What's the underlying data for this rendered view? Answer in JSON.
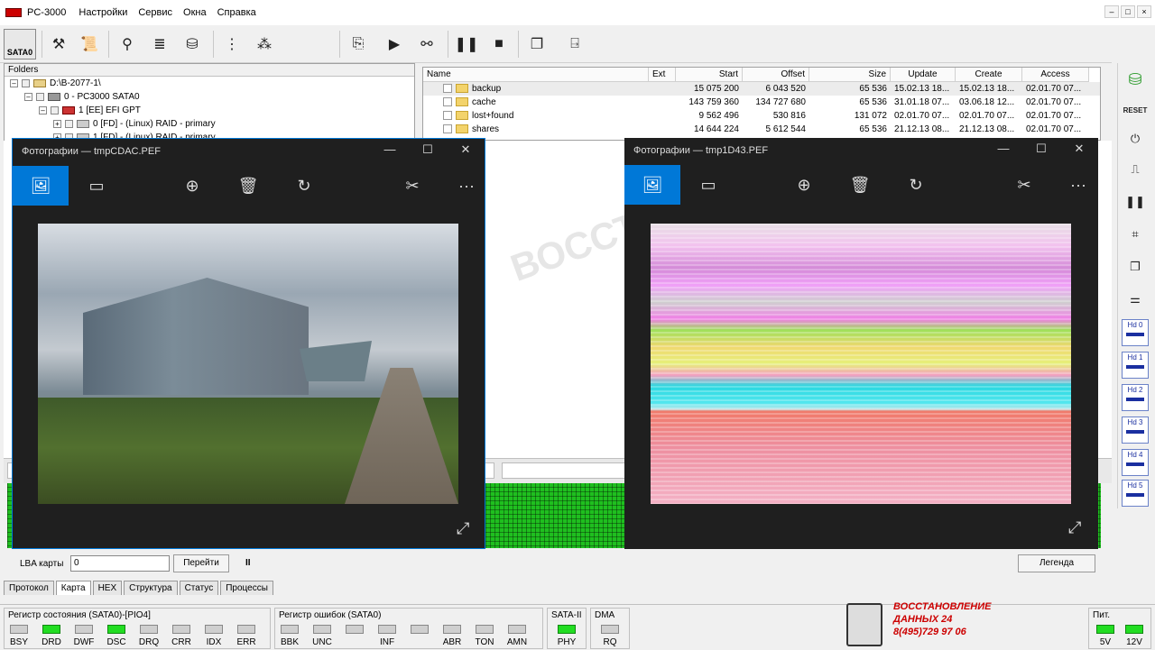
{
  "app": {
    "title": "PC-3000",
    "menu": [
      "Настройки",
      "Сервис",
      "Окна",
      "Справка"
    ],
    "win_min": "–",
    "win_max": "□",
    "win_close": "×"
  },
  "toolbar": {
    "sata_label": "SATA0"
  },
  "tree": {
    "header": "Folders",
    "nodes": [
      {
        "label": "D:\\B-2077-1\\"
      },
      {
        "label": "0 - PC3000 SATA0"
      },
      {
        "label": "1 [EE] EFI GPT"
      },
      {
        "label": "0 [FD] - (Linux) RAID - primary"
      },
      {
        "label": "1 [FD] - (Linux) RAID - primary"
      }
    ]
  },
  "files": {
    "columns": [
      "Name",
      "Ext",
      "Start",
      "Offset",
      "Size",
      "Update",
      "Create",
      "Access"
    ],
    "rows": [
      {
        "name": "backup",
        "ext": "",
        "start": "15 075 200",
        "offset": "6 043 520",
        "size": "65 536",
        "update": "15.02.13 18...",
        "create": "15.02.13 18...",
        "access": "02.01.70 07..."
      },
      {
        "name": "cache",
        "ext": "",
        "start": "143 759 360",
        "offset": "134 727 680",
        "size": "65 536",
        "update": "31.01.18 07...",
        "create": "03.06.18 12...",
        "access": "02.01.70 07..."
      },
      {
        "name": "lost+found",
        "ext": "",
        "start": "9 562 496",
        "offset": "530 816",
        "size": "131 072",
        "update": "02.01.70 07...",
        "create": "02.01.70 07...",
        "access": "02.01.70 07..."
      },
      {
        "name": "shares",
        "ext": "",
        "start": "14 644 224",
        "offset": "5 612 544",
        "size": "65 536",
        "update": "21.12.13 08...",
        "create": "21.12.13 08...",
        "access": "02.01.70 07..."
      }
    ]
  },
  "watermark": "ВОССТ  ЫХ-2",
  "photo_left": {
    "title": "Фотографии — tmpCDAC.PEF"
  },
  "photo_right": {
    "title": "Фотографии — tmp1D43.PEF"
  },
  "photo_icons": {
    "image": "🖼",
    "slideshow": "▭",
    "zoom": "⊕",
    "delete": "🗑",
    "rotate": "↻",
    "edit": "✂",
    "more": "···",
    "expand": "⤢",
    "min": "—",
    "max": "☐",
    "close": "✕"
  },
  "right_tools": {
    "reset": "RESET",
    "hd_buttons": [
      "Hd 0",
      "Hd 1",
      "Hd 2",
      "Hd 3",
      "Hd 4",
      "Hd 5"
    ]
  },
  "lba": {
    "label": "LBA карты",
    "value": "0",
    "go_button": "Перейти",
    "pause": "II",
    "legend_button": "Легенда"
  },
  "tabs": [
    "Протокол",
    "Карта",
    "HEX",
    "Структура",
    "Статус",
    "Процессы"
  ],
  "active_tab": "Карта",
  "status_register": {
    "title": "Регистр состояния (SATA0)-[PIO4]",
    "leds": [
      {
        "label": "BSY",
        "on": false
      },
      {
        "label": "DRD",
        "on": true
      },
      {
        "label": "DWF",
        "on": false
      },
      {
        "label": "DSC",
        "on": true
      },
      {
        "label": "DRQ",
        "on": false
      },
      {
        "label": "CRR",
        "on": false
      },
      {
        "label": "IDX",
        "on": false
      },
      {
        "label": "ERR",
        "on": false
      }
    ]
  },
  "error_register": {
    "title": "Регистр ошибок  (SATA0)",
    "leds": [
      {
        "label": "BBK",
        "on": false
      },
      {
        "label": "UNC",
        "on": false
      },
      {
        "label": "",
        "on": false
      },
      {
        "label": "INF",
        "on": false
      },
      {
        "label": "",
        "on": false
      },
      {
        "label": "ABR",
        "on": false
      },
      {
        "label": "TON",
        "on": false
      },
      {
        "label": "AMN",
        "on": false
      }
    ]
  },
  "sata": {
    "title": "SATA-II",
    "label": "PHY",
    "on": true
  },
  "dma": {
    "title": "DMA",
    "label": "RQ",
    "on": false
  },
  "power": {
    "title": "Пит.",
    "leds": [
      {
        "label": "5V",
        "on": true
      },
      {
        "label": "12V",
        "on": true
      }
    ]
  },
  "logo": {
    "line1": "ВОССТАНОВЛЕНИЕ",
    "line2": "ДАННЫХ  24",
    "line3": "8(495)729 97 06"
  },
  "colors": {
    "accent": "#0078d7",
    "led_on": "#22dd22",
    "logo": "#cc0000"
  }
}
